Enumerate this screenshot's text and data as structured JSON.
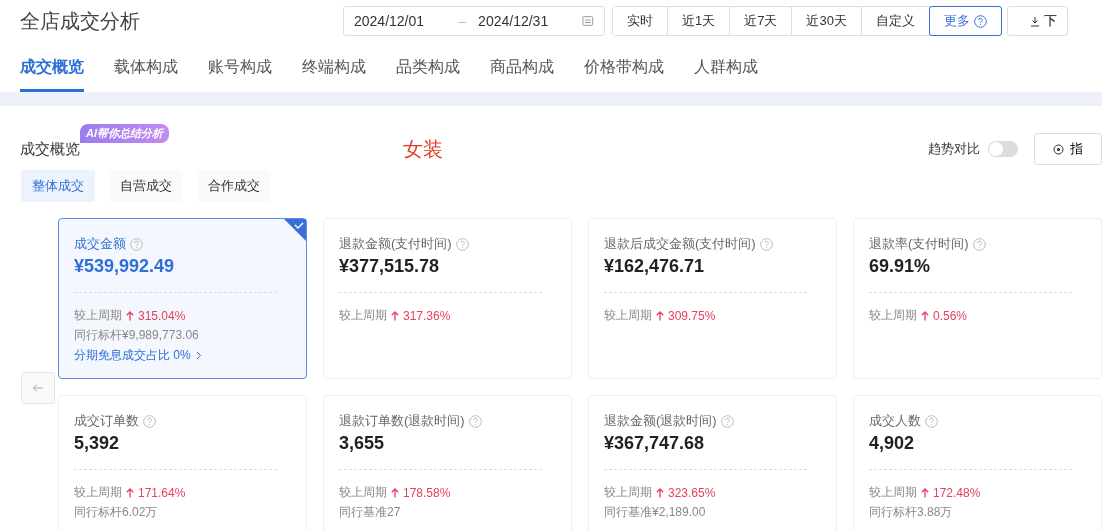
{
  "page_title": "全店成交分析",
  "date_range": {
    "start": "2024/12/01",
    "separator": "–",
    "end": "2024/12/31"
  },
  "period_buttons": [
    {
      "label": "实时",
      "selected": false
    },
    {
      "label": "近1天",
      "selected": false
    },
    {
      "label": "近7天",
      "selected": false
    },
    {
      "label": "近30天",
      "selected": false
    },
    {
      "label": "自定义",
      "selected": false
    },
    {
      "label": "更多",
      "selected": true
    }
  ],
  "download_button": "下",
  "tabs": [
    {
      "label": "成交概览",
      "selected": true
    },
    {
      "label": "载体构成",
      "selected": false
    },
    {
      "label": "账号构成",
      "selected": false
    },
    {
      "label": "终端构成",
      "selected": false
    },
    {
      "label": "品类构成",
      "selected": false
    },
    {
      "label": "商品构成",
      "selected": false
    },
    {
      "label": "价格带构成",
      "selected": false
    },
    {
      "label": "人群构成",
      "selected": false
    }
  ],
  "section": {
    "title": "成交概览",
    "ai_badge": "AI帮你总结分析",
    "category": "女装",
    "trend_label": "趋势对比",
    "trend_on": false,
    "metrics_button": "指"
  },
  "subtabs": [
    {
      "label": "整体成交",
      "selected": true
    },
    {
      "label": "自营成交",
      "selected": false
    },
    {
      "label": "合作成交",
      "selected": false
    }
  ],
  "cards": [
    {
      "title": "成交金额",
      "value": "¥539,992.49",
      "compare_label": "较上周期",
      "change": "315.04%",
      "benchmark": "同行标杆¥9,989,773.06",
      "link": "分期免息成交占比 0%",
      "selected": true
    },
    {
      "title": "退款金额(支付时间)",
      "value": "¥377,515.78",
      "compare_label": "较上周期",
      "change": "317.36%",
      "selected": false
    },
    {
      "title": "退款后成交金额(支付时间)",
      "value": "¥162,476.71",
      "compare_label": "较上周期",
      "change": "309.75%",
      "selected": false
    },
    {
      "title": "退款率(支付时间)",
      "value": "69.91%",
      "compare_label": "较上周期",
      "change": "0.56%",
      "selected": false
    },
    {
      "title": "成交订单数",
      "value": "5,392",
      "compare_label": "较上周期",
      "change": "171.64%",
      "benchmark": "同行标杆6.02万",
      "selected": false
    },
    {
      "title": "退款订单数(退款时间)",
      "value": "3,655",
      "compare_label": "较上周期",
      "change": "178.58%",
      "benchmark": "同行基准27",
      "selected": false
    },
    {
      "title": "退款金额(退款时间)",
      "value": "¥367,747.68",
      "compare_label": "较上周期",
      "change": "323.65%",
      "benchmark": "同行基准¥2,189.00",
      "selected": false
    },
    {
      "title": "成交人数",
      "value": "4,902",
      "compare_label": "较上周期",
      "change": "172.48%",
      "benchmark": "同行标杆3.88万",
      "selected": false
    }
  ]
}
